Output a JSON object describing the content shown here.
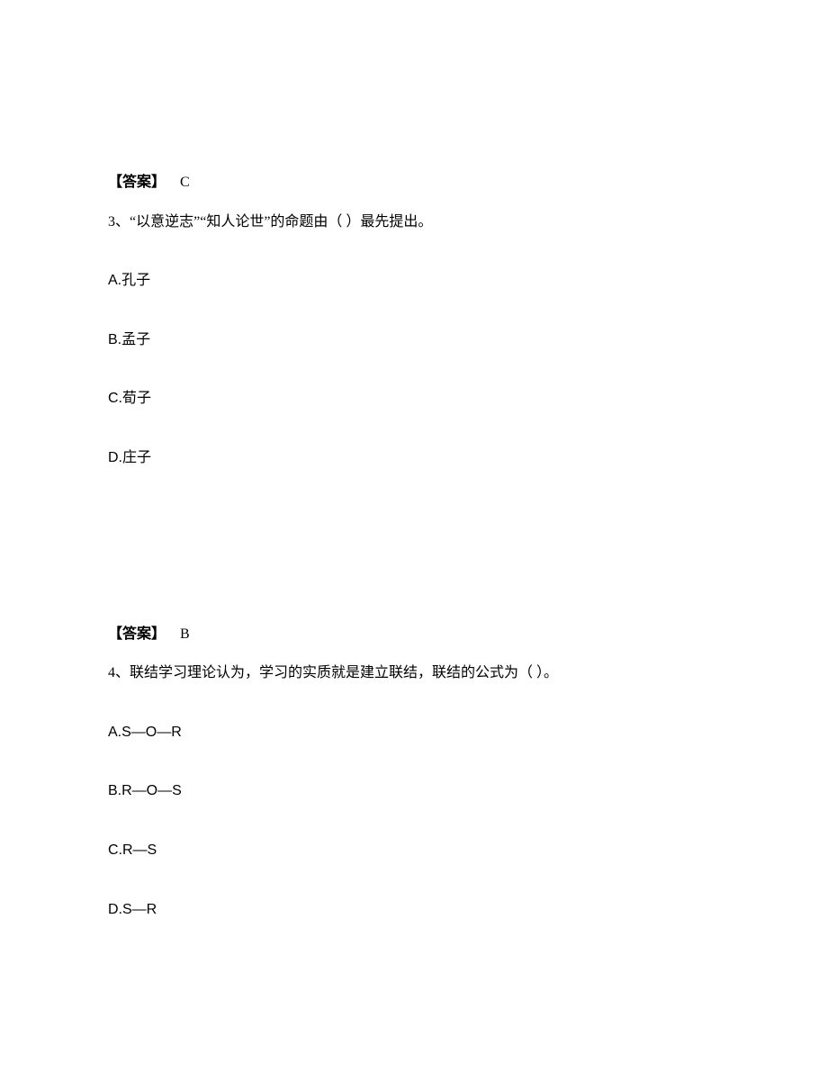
{
  "q2": {
    "answer_label": "【答案】",
    "answer_value": "C"
  },
  "q3": {
    "number": "3、",
    "text": "“以意逆志”“知人论世”的命题由（ ）最先提出。",
    "options": {
      "a": "A.孔子",
      "b": "B.孟子",
      "c": "C.荀子",
      "d": "D.庄子"
    },
    "answer_label": "【答案】",
    "answer_value": "B"
  },
  "q4": {
    "number": "4、",
    "text": "联结学习理论认为，学习的实质就是建立联结，联结的公式为（ ）。",
    "options": {
      "a": "A.S—O—R",
      "b": "B.R—O—S",
      "c": "C.R—S",
      "d": "D.S—R"
    }
  }
}
